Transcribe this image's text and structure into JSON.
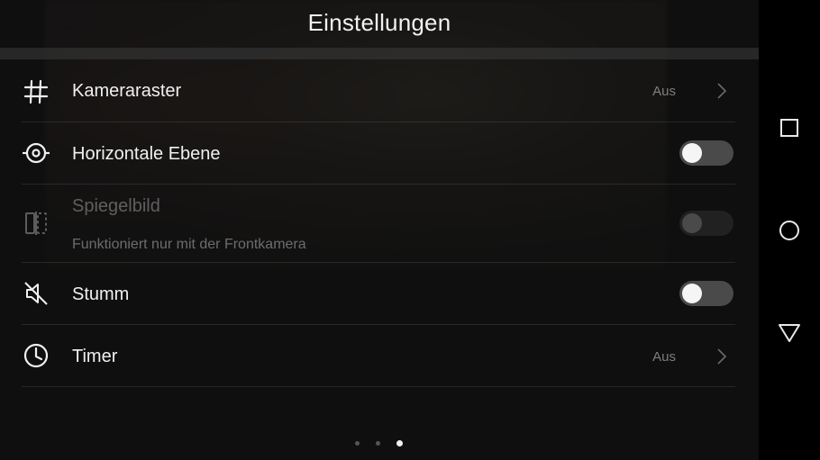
{
  "header": {
    "title": "Einstellungen"
  },
  "settings": [
    {
      "label": "Kameraraster",
      "value": "Aus",
      "icon": "grid-icon",
      "control": "chevron"
    },
    {
      "label": "Horizontale Ebene",
      "icon": "level-icon",
      "control": "toggle",
      "on": false
    },
    {
      "label": "Spiegelbild",
      "subtitle": "Funktioniert nur mit der Frontkamera",
      "icon": "mirror-icon",
      "control": "toggle",
      "on": false,
      "disabled": true
    },
    {
      "label": "Stumm",
      "icon": "mute-icon",
      "control": "toggle",
      "on": false
    },
    {
      "label": "Timer",
      "value": "Aus",
      "icon": "timer-icon",
      "control": "chevron"
    }
  ],
  "pager": {
    "pages": 3,
    "active_page": 3
  },
  "navigation": {
    "buttons": [
      "recents-button",
      "home-button",
      "back-button"
    ]
  },
  "colors": {
    "background": "#121212",
    "text": "#f0f0f0",
    "muted": "#8a8a8a",
    "toggle_off": "#4a4a4a"
  }
}
